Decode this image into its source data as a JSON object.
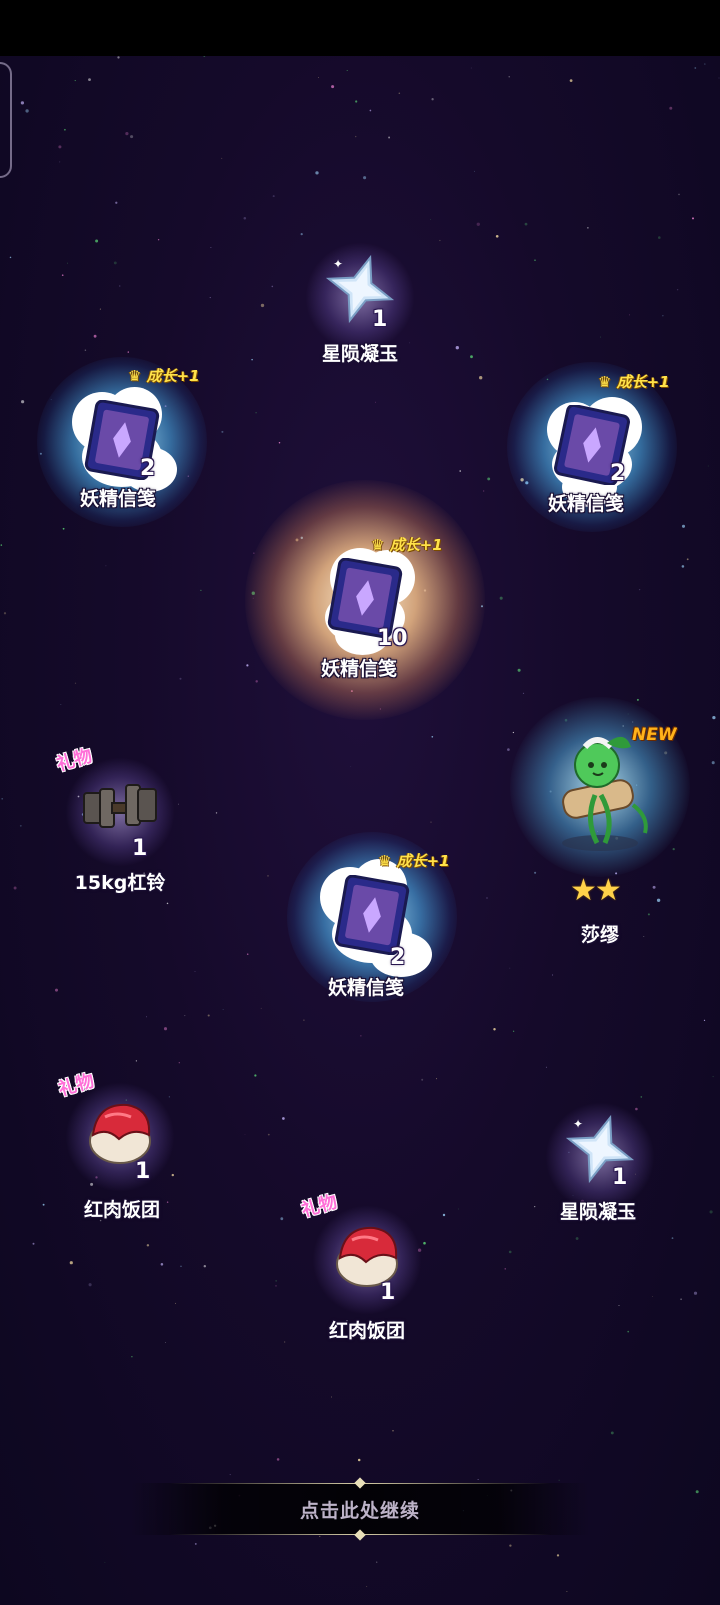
{
  "rewards": [
    {
      "name": "星陨凝玉",
      "qty": "1",
      "icon": "star-crystal-icon"
    },
    {
      "name": "妖精信笺",
      "qty": "2",
      "icon": "fairy-letter-card-icon",
      "badge": "成长+1"
    },
    {
      "name": "妖精信笺",
      "qty": "2",
      "icon": "fairy-letter-card-icon",
      "badge": "成长+1"
    },
    {
      "name": "妖精信笺",
      "qty": "10",
      "icon": "fairy-letter-card-icon",
      "badge": "成长+1"
    },
    {
      "name": "15kg杠铃",
      "qty": "1",
      "icon": "dumbbell-icon",
      "badge": "礼物"
    },
    {
      "name": "莎缪",
      "icon": "plant-character-portrait",
      "badge": "NEW",
      "stars": 2
    },
    {
      "name": "妖精信笺",
      "qty": "2",
      "icon": "fairy-letter-card-icon",
      "badge": "成长+1"
    },
    {
      "name": "红肉饭团",
      "qty": "1",
      "icon": "meat-rice-ball-icon",
      "badge": "礼物"
    },
    {
      "name": "星陨凝玉",
      "qty": "1",
      "icon": "star-crystal-icon"
    },
    {
      "name": "红肉饭团",
      "qty": "1",
      "icon": "meat-rice-ball-icon",
      "badge": "礼物"
    }
  ],
  "continue_label": "点击此处继续",
  "colors": {
    "background": "#150a2a",
    "growth_badge": "#ffe24a",
    "gift_badge": "#ff6fd8",
    "new_badge": "#ffb21a",
    "rarity_glow": "#5ac8ff",
    "highlight_glow": "#ffc88c"
  }
}
